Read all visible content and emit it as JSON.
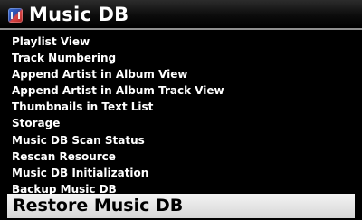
{
  "header": {
    "title": "Music DB",
    "icon": "music-db-icon"
  },
  "menu": {
    "items": [
      {
        "label": "Playlist View"
      },
      {
        "label": "Track Numbering"
      },
      {
        "label": "Append Artist in Album View"
      },
      {
        "label": "Append Artist in Album Track View"
      },
      {
        "label": "Thumbnails in Text List"
      },
      {
        "label": "Storage"
      },
      {
        "label": "Music DB Scan Status"
      },
      {
        "label": "Rescan Resource"
      },
      {
        "label": "Music DB Initialization"
      },
      {
        "label": "Backup Music DB"
      }
    ],
    "selected": {
      "label": "Restore Music DB"
    }
  },
  "colors": {
    "background": "#000000",
    "text": "#ffffff",
    "highlight_bg": "#e6e6e6",
    "highlight_text": "#000000"
  }
}
